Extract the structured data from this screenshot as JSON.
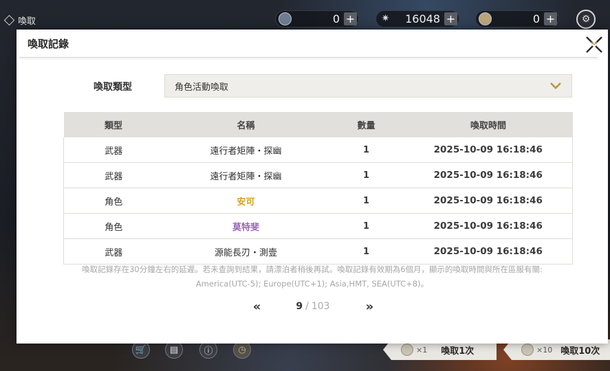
{
  "header": {
    "page_label": "喚取",
    "currencies": [
      {
        "icon": "coin-icon",
        "value": "0"
      },
      {
        "icon": "star-crystal-icon",
        "value": "16048"
      },
      {
        "icon": "gold-coin-icon",
        "value": "0"
      }
    ],
    "plus_symbol": "+",
    "settings_icon": "gear-icon"
  },
  "bottom": {
    "icons": [
      "shop-icon",
      "receipt-icon",
      "info-icon",
      "clock-icon"
    ],
    "pull_one": {
      "mult": "×1",
      "label": "喚取1次"
    },
    "pull_ten": {
      "mult": "×10",
      "label": "喚取10次"
    }
  },
  "modal": {
    "title": "喚取記錄",
    "filter_label": "喚取類型",
    "filter_value": "角色活動喚取",
    "columns": [
      "類型",
      "名稱",
      "數量",
      "喚取時間"
    ],
    "rows": [
      {
        "type": "武器",
        "name": "遠行者矩陣・探幽",
        "qty": "1",
        "time": "2025-10-09 16:18:46",
        "rarity": "normal"
      },
      {
        "type": "武器",
        "name": "遠行者矩陣・探幽",
        "qty": "1",
        "time": "2025-10-09 16:18:46",
        "rarity": "normal"
      },
      {
        "type": "角色",
        "name": "安可",
        "qty": "1",
        "time": "2025-10-09 16:18:46",
        "rarity": "gold"
      },
      {
        "type": "角色",
        "name": "莫特斐",
        "qty": "1",
        "time": "2025-10-09 16:18:46",
        "rarity": "purple"
      },
      {
        "type": "武器",
        "name": "源能長刃・測壹",
        "qty": "1",
        "time": "2025-10-09 16:18:46",
        "rarity": "normal"
      }
    ],
    "notice_line1": "喚取記錄存在30分鐘左右的延遲。若未查詢到結果，請漂泊者稍後再試。喚取記錄有效期為6個月，顯示的喚取時間與所在區服有關:",
    "notice_line2": "America(UTC-5); Europe(UTC+1); Asia,HMT, SEA(UTC+8)。",
    "pager": {
      "prev": "«",
      "current": "9",
      "sep": "/",
      "total": "103",
      "next": "»"
    }
  },
  "colors": {
    "rarity_gold": "#d4a21e",
    "rarity_purple": "#9a66b8",
    "table_header_bg": "#e2e0dc"
  }
}
